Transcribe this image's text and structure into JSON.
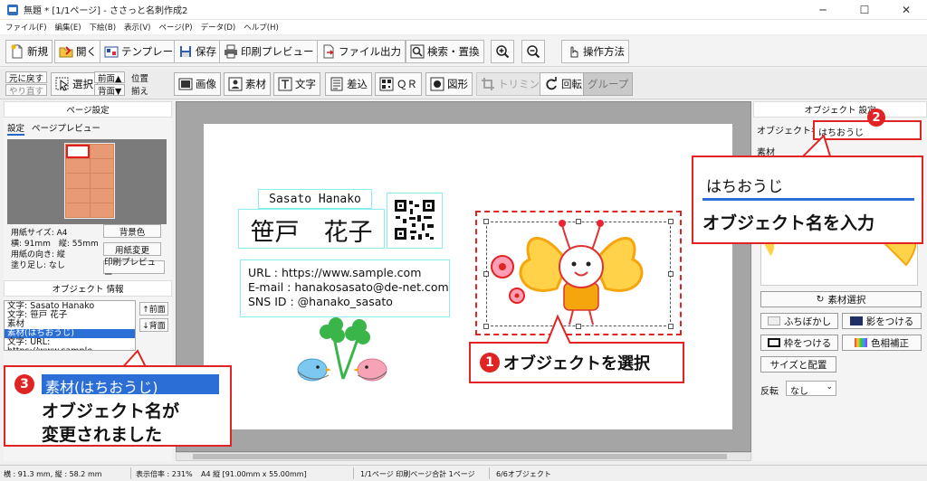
{
  "window": {
    "title": "無題 * [1/1ページ] - ささっと名刺作成2",
    "minimize": "─",
    "maximize": "☐",
    "close": "✕"
  },
  "menu": [
    "ファイル(F)",
    "編集(E)",
    "下絵(B)",
    "表示(V)",
    "ページ(P)",
    "データ(D)",
    "ヘルプ(H)"
  ],
  "toolbar": {
    "new": "新規",
    "open": "開く",
    "template": "テンプレート",
    "save": "保存",
    "print_preview": "印刷プレビュー",
    "file_output": "ファイル出力",
    "search_replace": "検索・置換",
    "operation": "操作方法"
  },
  "toolbar2": {
    "undo": "元に戻す",
    "redo": "やり直す",
    "select": "選択",
    "front": "前面▲",
    "back": "背面▼",
    "align_1": "位置",
    "align_2": "揃え",
    "image": "画像",
    "material": "素材",
    "text": "文字",
    "merge": "差込",
    "qr": "ＱＲ",
    "shape": "図形",
    "trimming": "トリミング",
    "rotate": "回転",
    "group": "グループ"
  },
  "page_settings": {
    "header": "ページ設定",
    "tab_settings": "設定",
    "tab_preview": "ページプレビュー",
    "paper_size": "用紙サイズ: A4",
    "dimensions": "横: 91mm　縦: 55mm",
    "orientation": "用紙の向き: 縦",
    "bleed": "塗り足し: なし",
    "bg_color_btn": "背景色",
    "change_paper_btn": "用紙変更",
    "print_preview_btn": "印刷プレビュー"
  },
  "object_info": {
    "header": "オブジェクト 情報",
    "items": [
      "文字: Sasato Hanako",
      "文字: 笹戸 花子",
      "素材"
    ],
    "selected": "素材(はちおうじ)",
    "after": "文字: URL: https://www.sample.",
    "front_btn": "↑前面",
    "back_btn": "↓背面"
  },
  "card": {
    "name_roman": "Sasato Hanako",
    "name_jp": "笹戸　花子",
    "url": "URL : https://www.sample.com",
    "email": "E-mail : hanakosasato@de-net.com",
    "sns": "SNS ID : @hanako_sasato"
  },
  "object_settings": {
    "header": "オブジェクト 設定",
    "name_label": "オブジェクト名",
    "name_value": "はちおうじ",
    "material_label": "素材",
    "select_material_btn": "素材選択",
    "blur_btn": "ふちぼかし",
    "shadow_btn": "影をつける",
    "frame_btn": "枠をつける",
    "color_btn": "色相補正",
    "size_pos_btn": "サイズと配置",
    "flip_label": "反転",
    "flip_value": "なし"
  },
  "callouts": {
    "c1_num": "1",
    "c1_text": "オブジェクトを選択",
    "c2_num": "2",
    "c2_input": "はちおうじ",
    "c2_text": "オブジェクト名を入力",
    "c3_num": "3",
    "c3_highlight": "素材(はちおうじ)",
    "c3_text_1": "オブジェクト名が",
    "c3_text_2": "変更されました"
  },
  "status": {
    "size": "横 : 91.3 mm, 縦 : 58.2 mm",
    "zoom": "表示倍率 : 231%",
    "paper": "A4 縦 [91.00mm x 55.00mm]",
    "pages": "1/1ページ 印刷ページ合計 1ページ",
    "objects": "6/6オブジェクト"
  },
  "colors": {
    "accent_red": "#e12323",
    "selection_blue": "#2b6fd6",
    "butterfly_orange": "#f5a60c",
    "butterfly_yellow": "#ffd24a"
  }
}
